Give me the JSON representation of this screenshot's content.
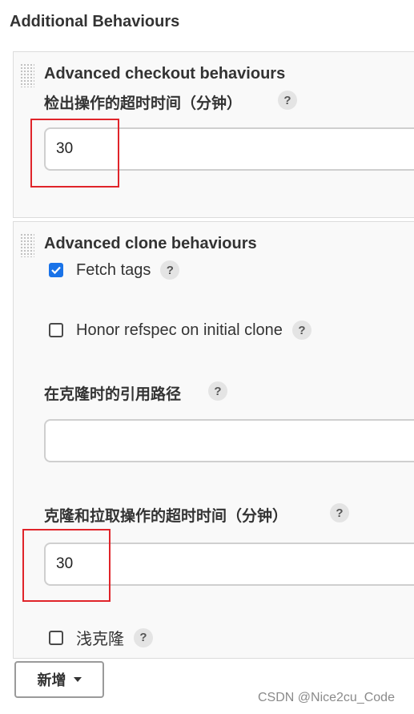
{
  "section_title": "Additional Behaviours",
  "checkout": {
    "title": "Advanced checkout behaviours",
    "timeout_label": "检出操作的超时时间（分钟）",
    "timeout_value": "30"
  },
  "clone": {
    "title": "Advanced clone behaviours",
    "fetch_tags_label": "Fetch tags",
    "fetch_tags_checked": true,
    "honor_refspec_label": "Honor refspec on initial clone",
    "honor_refspec_checked": false,
    "ref_path_label": "在克隆时的引用路径",
    "ref_path_value": "",
    "timeout_label": "克隆和拉取操作的超时时间（分钟）",
    "timeout_value": "30",
    "shallow_label": "浅克隆",
    "shallow_checked": false
  },
  "help_glyph": "?",
  "add_button_label": "新增",
  "watermark": "CSDN @Nice2cu_Code",
  "colors": {
    "checkbox_accent": "#1a73e8",
    "highlight_box": "#e0242a"
  }
}
